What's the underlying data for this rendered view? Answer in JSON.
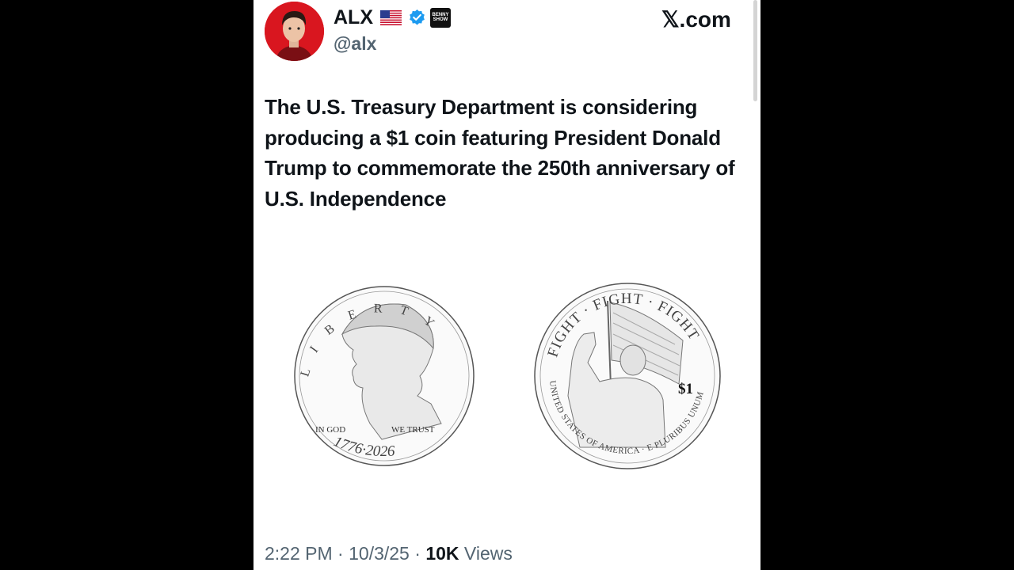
{
  "author": {
    "name": "ALX",
    "flag_emoji": "🇺🇸",
    "handle": "@alx",
    "verified": true,
    "affiliate_badge_text": "BENNY SHOW"
  },
  "site": "𝕏.com",
  "tweet": {
    "text": "The U.S. Treasury Department is considering producing a $1 coin featuring President Donald Trump to commemorate the 250th anniversary of U.S. Independence"
  },
  "coins": {
    "obverse": {
      "top_text": "LIBERTY",
      "motto_left": "IN GOD",
      "motto_right": "WE TRUST",
      "years": "1776·2026"
    },
    "reverse": {
      "top_text": "FIGHT · FIGHT · FIGHT",
      "denomination": "$1",
      "bottom_text": "UNITED STATES OF AMERICA · E PLURIBUS UNUM"
    }
  },
  "meta": {
    "time": "2:22 PM",
    "date": "10/3/25",
    "views_count": "10K",
    "views_label": "Views"
  },
  "colors": {
    "text_primary": "#0f1419",
    "text_secondary": "#536471",
    "verified_blue": "#1d9bf0",
    "avatar_bg": "#d9161f"
  }
}
